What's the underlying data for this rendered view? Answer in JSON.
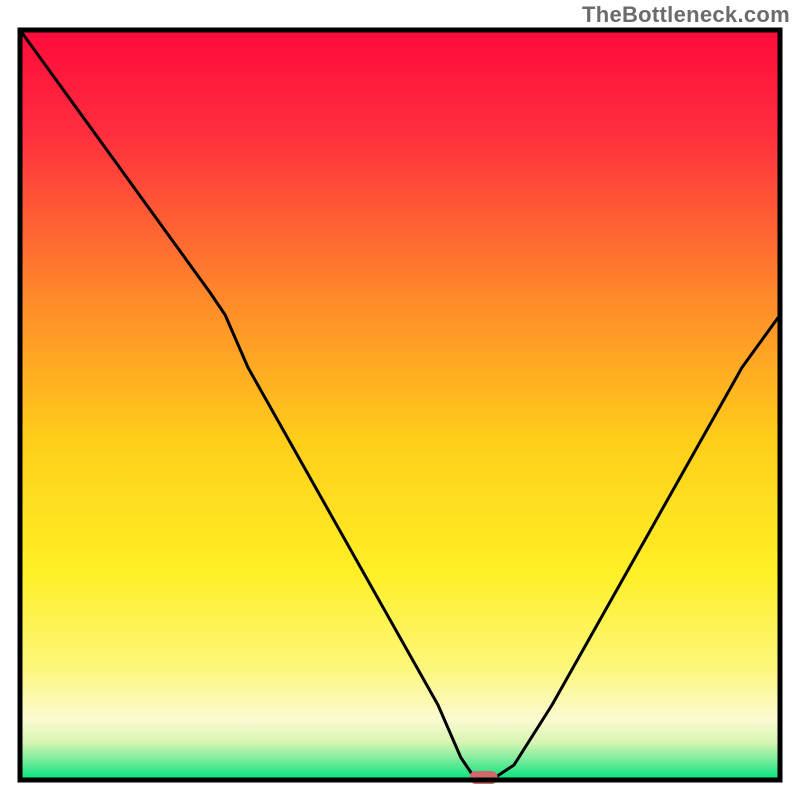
{
  "watermark": "TheBottleneck.com",
  "colors": {
    "frame": "#000000",
    "curve": "#000000",
    "marker": "#d06a6a",
    "gradient_top": "#ff0a3c",
    "gradient_mid": "#ffef00",
    "gradient_band_light": "#fdfac8",
    "gradient_bottom": "#00e27a"
  },
  "chart_data": {
    "type": "line",
    "title": "",
    "xlabel": "",
    "ylabel": "",
    "xlim": [
      0,
      100
    ],
    "ylim": [
      0,
      100
    ],
    "grid": false,
    "legend": false,
    "x": [
      0,
      5,
      10,
      15,
      20,
      25,
      27,
      30,
      35,
      40,
      45,
      50,
      55,
      58,
      60,
      62,
      65,
      70,
      75,
      80,
      85,
      90,
      95,
      100
    ],
    "values": [
      100,
      93,
      86,
      79,
      72,
      65,
      62,
      55,
      46,
      37,
      28,
      19,
      10,
      3,
      0,
      0,
      2,
      10,
      19,
      28,
      37,
      46,
      55,
      62
    ],
    "marker_x": 61,
    "marker_y": 0,
    "note": "V-shaped bottleneck curve on a vertical red→yellow→green gradient. Minimum (0) around x≈60–62 marked by a small rounded pill at the bottom. Values are estimates read from the unlabeled axes (0–100 scale)."
  }
}
